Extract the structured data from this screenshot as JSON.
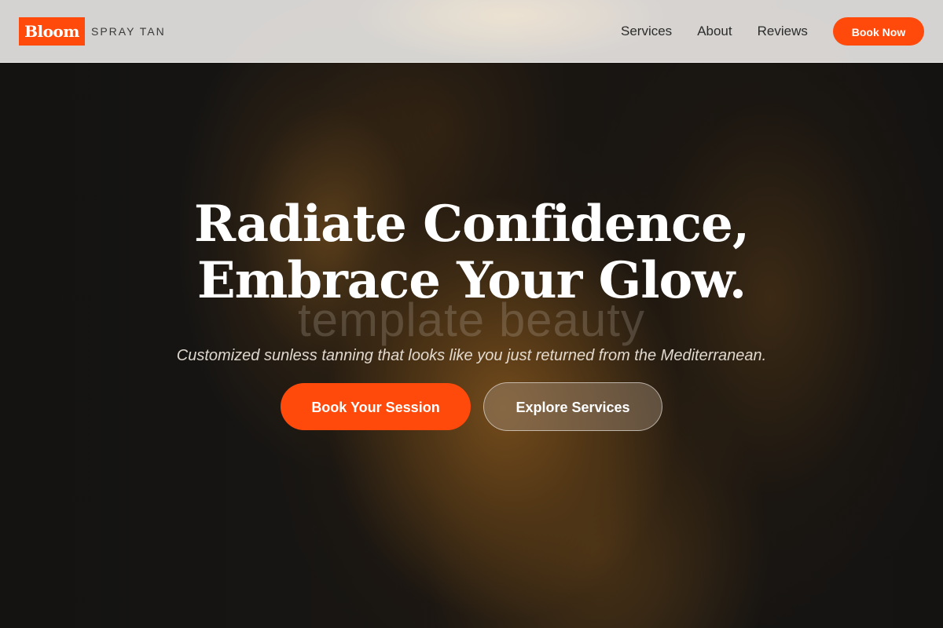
{
  "brand": {
    "logo_text": "Bloom",
    "tagline": "SPRAY TAN",
    "accent_color": "#ff4a0b"
  },
  "nav": {
    "links": [
      "Services",
      "About",
      "Reviews"
    ],
    "cta_label": "Book Now"
  },
  "hero": {
    "title_line1": "Radiate Confidence,",
    "title_line2": "Embrace Your Glow.",
    "watermark": "template beauty",
    "subtitle": "Customized sunless tanning that looks like you just returned from the Mediterranean.",
    "primary_button": "Book Your Session",
    "secondary_button": "Explore Services"
  }
}
